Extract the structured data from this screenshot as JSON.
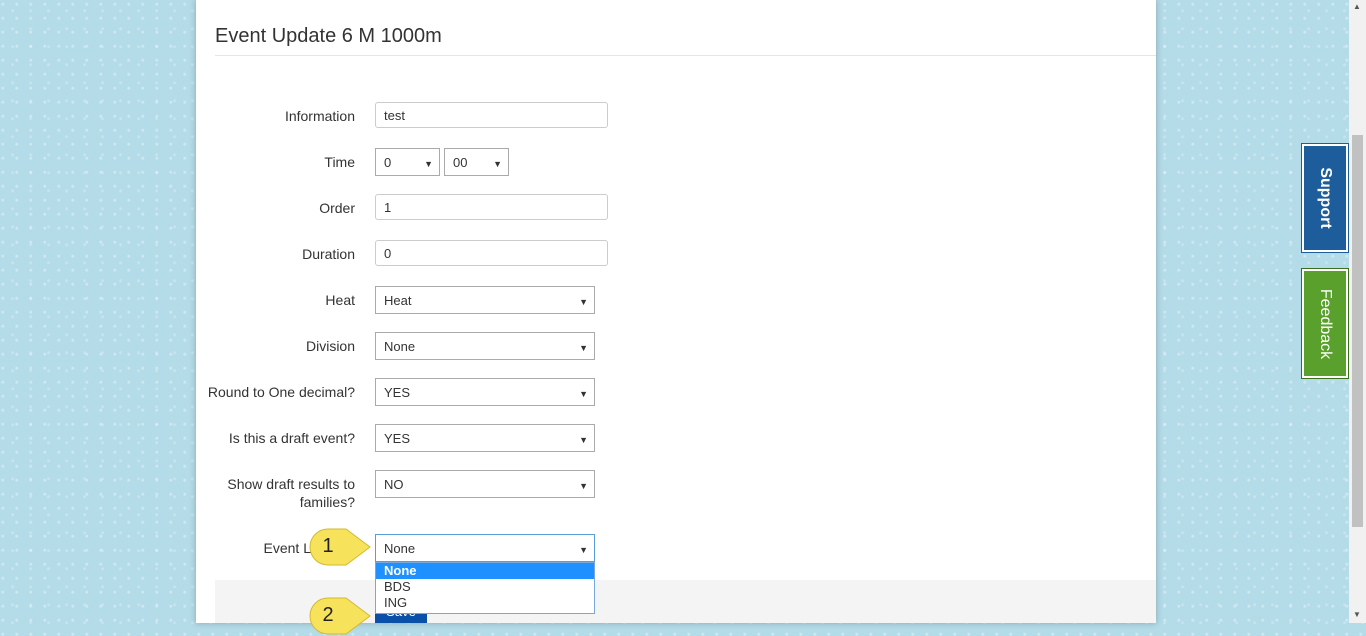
{
  "page": {
    "title": "Event Update 6 M 1000m"
  },
  "form": {
    "information": {
      "label": "Information",
      "value": "test"
    },
    "time": {
      "label": "Time",
      "hour": "0",
      "minute": "00"
    },
    "order": {
      "label": "Order",
      "value": "1"
    },
    "duration": {
      "label": "Duration",
      "value": "0"
    },
    "heat": {
      "label": "Heat",
      "value": "Heat"
    },
    "division": {
      "label": "Division",
      "value": "None"
    },
    "round": {
      "label": "Round to One decimal?",
      "value": "YES"
    },
    "draft": {
      "label": "Is this a draft event?",
      "value": "YES"
    },
    "show_draft": {
      "label_line1": "Show draft results to",
      "label_line2": "families?",
      "value": "NO"
    },
    "event_l": {
      "label": "Event L",
      "value": "None",
      "options": [
        "None",
        "BDS",
        "ING"
      ],
      "selected": "None"
    }
  },
  "buttons": {
    "save": "Save"
  },
  "callouts": [
    "1",
    "2"
  ],
  "side_tabs": {
    "support": "Support",
    "feedback": "Feedback"
  },
  "colors": {
    "support": "#1d5d9b",
    "feedback": "#5aa02c",
    "save": "#0a4fa8",
    "highlight": "#1e90ff",
    "callout": "#f7e35b"
  }
}
